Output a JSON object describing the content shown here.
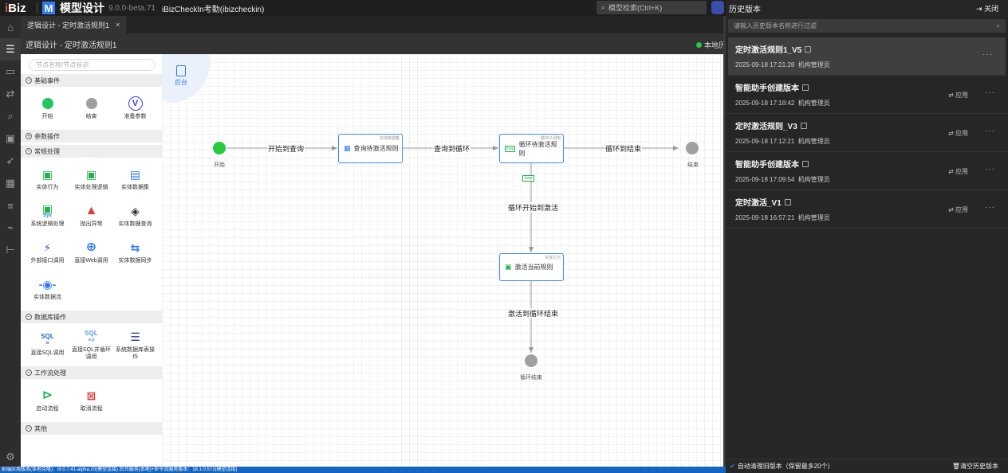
{
  "topbar": {
    "logo_prefix": "i",
    "logo": "Biz",
    "m_logo": "M",
    "app_title": "模型设计",
    "version": "9.0.0-beta.71",
    "project": "iBizCheckIn考勤(ibizcheckin)",
    "search_placeholder": "模型检索(Ctrl+K)"
  },
  "tabs": [
    {
      "label": "逻辑设计 - 定时激活规则1",
      "close": "×"
    }
  ],
  "header": {
    "title": "逻辑设计 - 定时激活规则1",
    "status": "本地历"
  },
  "palette": {
    "search_placeholder": "节点名称/节点标识",
    "sections": {
      "basic": {
        "title": "基础事件",
        "toggle": "−",
        "items": [
          "开始",
          "结束",
          "准备参数"
        ]
      },
      "param": {
        "title": "参数操作",
        "toggle": "+"
      },
      "common": {
        "title": "常规处理",
        "toggle": "−",
        "items": [
          "实体行为",
          "实体处理逻辑",
          "实体数据集",
          "系统逻辑处理",
          "抛出异常",
          "实体数据查询",
          "外部接口调用",
          "直接Web调用",
          "实体数据同步",
          "实体数据流"
        ]
      },
      "db": {
        "title": "数据库操作",
        "toggle": "−",
        "items": [
          "直接SQL调用",
          "直接SQL并循环调用",
          "系统数据库表操作"
        ]
      },
      "workflow": {
        "title": "工作流处理",
        "toggle": "−",
        "items": [
          "启动流程",
          "取消流程"
        ]
      },
      "other": {
        "title": "其他",
        "toggle": "−"
      }
    },
    "icon_texts": {
      "v": "V",
      "sys": "Sys",
      "sql": "SQL"
    }
  },
  "canvas": {
    "backend_label": "后台",
    "nodes": {
      "start": "开始",
      "query": {
        "label": "查询待激活规则",
        "tag": "实体数据集"
      },
      "loop": {
        "label": "循环待激活规则",
        "tag": "循环子调用",
        "badge": "loop"
      },
      "end": "结束",
      "activate": {
        "label": "激活当前规则",
        "tag": "实体行为"
      },
      "loop_end": "循环结束",
      "loop_badge": "loop"
    },
    "edges": {
      "e1": "开始到查询",
      "e2": "查询到循环",
      "e3": "循环到结束",
      "e4": "循环开始到激活",
      "e5": "激活到循环结束"
    }
  },
  "statusbar": "前端应用版本(本地克隆)：i9.0.7.41-alpha.20(模型连接) 后台服务(本地)+命令流服务版本：18.1.0.572(模型连接)",
  "history": {
    "title": "历史版本",
    "close_label": "关闭",
    "filter_placeholder": "请输入历史版本名称进行过滤",
    "apply_label": "应用",
    "more": "···",
    "items": [
      {
        "name": "定时激活规则1_V5",
        "time": "2025-09-18 17:21:28",
        "user": "机构管理员",
        "selected": true
      },
      {
        "name": "智能助手创建版本",
        "time": "2025-09-18 17:18:42",
        "user": "机构管理员"
      },
      {
        "name": "定时激活规则_V3",
        "time": "2025-09-18 17:12:21",
        "user": "机构管理员"
      },
      {
        "name": "智能助手创建版本",
        "time": "2025-09-18 17:09:54",
        "user": "机构管理员"
      },
      {
        "name": "定时激活_V1",
        "time": "2025-09-18 16:57:21",
        "user": "机构管理员"
      }
    ],
    "footer_auto": "自动清理旧版本（保留最多20个）",
    "footer_clear": "清空历史版本"
  },
  "colors": {
    "accent": "#2f7cf6",
    "start": "#27c93f",
    "end": "#a0a0a0",
    "error": "#e53935",
    "workflow": "#22b14c",
    "cancel": "#e53935",
    "purple": "#6a3ddd"
  }
}
